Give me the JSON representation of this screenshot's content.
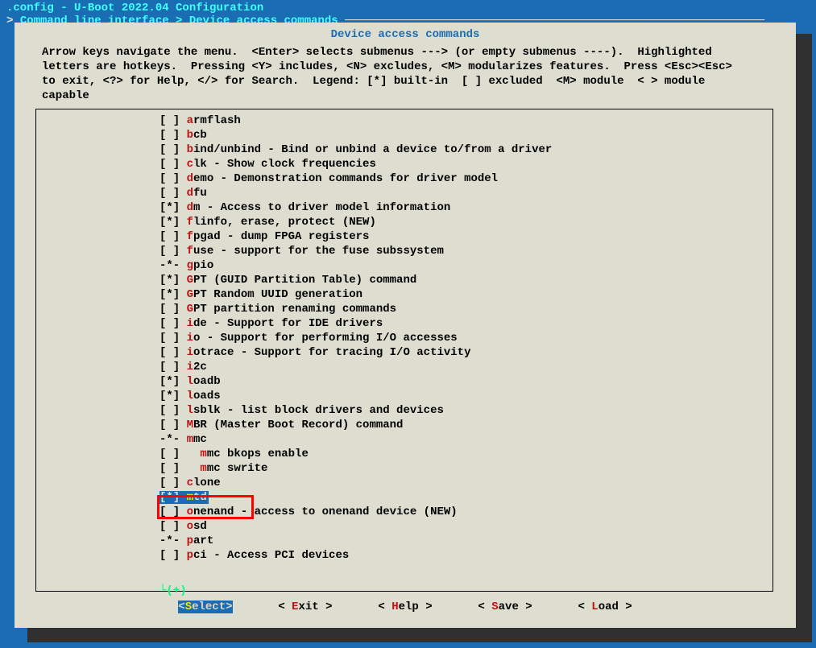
{
  "window": {
    "title": ".config - U-Boot 2022.04 Configuration",
    "breadcrumb_prefix": "> ",
    "breadcrumb_1": "Command line interface",
    "breadcrumb_sep": " > ",
    "breadcrumb_2": "Device access commands",
    "breadcrumb_trail": " ──────────────────────────────────────────────────────────────"
  },
  "box": {
    "title": "Device access commands",
    "help": "Arrow keys navigate the menu.  <Enter> selects submenus ---> (or empty submenus ----).  Highlighted\nletters are hotkeys.  Pressing <Y> includes, <N> excludes, <M> modularizes features.  Press <Esc><Esc>\nto exit, <?> for Help, </> for Search.  Legend: [*] built-in  [ ] excluded  <M> module  < > module\ncapable",
    "more": "└(+)"
  },
  "items": [
    {
      "state": "[ ] ",
      "hotkey": "a",
      "rest": "rmflash",
      "sel": false
    },
    {
      "state": "[ ] ",
      "hotkey": "b",
      "rest": "cb",
      "sel": false
    },
    {
      "state": "[ ] ",
      "hotkey": "b",
      "rest": "ind/unbind - Bind or unbind a device to/from a driver",
      "sel": false
    },
    {
      "state": "[ ] ",
      "hotkey": "c",
      "rest": "lk - Show clock frequencies",
      "sel": false
    },
    {
      "state": "[ ] ",
      "hotkey": "d",
      "rest": "emo - Demonstration commands for driver model",
      "sel": false
    },
    {
      "state": "[ ] ",
      "hotkey": "d",
      "rest": "fu",
      "sel": false
    },
    {
      "state": "[*] ",
      "hotkey": "d",
      "rest": "m - Access to driver model information",
      "sel": false
    },
    {
      "state": "[*] ",
      "hotkey": "f",
      "rest": "linfo, erase, protect (NEW)",
      "sel": false
    },
    {
      "state": "[ ] ",
      "hotkey": "f",
      "rest": "pgad - dump FPGA registers",
      "sel": false
    },
    {
      "state": "[ ] ",
      "hotkey": "f",
      "rest": "use - support for the fuse subssystem",
      "sel": false
    },
    {
      "state": "-*- ",
      "hotkey": "g",
      "rest": "pio",
      "sel": false
    },
    {
      "state": "[*] ",
      "hotkey": "G",
      "rest": "PT (GUID Partition Table) command",
      "sel": false
    },
    {
      "state": "[*] ",
      "hotkey": "G",
      "rest": "PT Random UUID generation",
      "sel": false
    },
    {
      "state": "[ ] ",
      "hotkey": "G",
      "rest": "PT partition renaming commands",
      "sel": false
    },
    {
      "state": "[ ] ",
      "hotkey": "i",
      "rest": "de - Support for IDE drivers",
      "sel": false
    },
    {
      "state": "[ ] ",
      "hotkey": "i",
      "rest": "o - Support for performing I/O accesses",
      "sel": false
    },
    {
      "state": "[ ] ",
      "hotkey": "i",
      "rest": "otrace - Support for tracing I/O activity",
      "sel": false
    },
    {
      "state": "[ ] ",
      "hotkey": "i",
      "rest": "2c",
      "sel": false
    },
    {
      "state": "[*] ",
      "hotkey": "l",
      "rest": "oadb",
      "sel": false
    },
    {
      "state": "[*] ",
      "hotkey": "l",
      "rest": "oads",
      "sel": false
    },
    {
      "state": "[ ] ",
      "hotkey": "l",
      "rest": "sblk - list block drivers and devices",
      "sel": false
    },
    {
      "state": "[ ] ",
      "hotkey": "M",
      "rest": "BR (Master Boot Record) command",
      "sel": false
    },
    {
      "state": "-*- ",
      "hotkey": "m",
      "rest": "mc",
      "sel": false
    },
    {
      "state": "[ ]   ",
      "hotkey": "m",
      "rest": "mc bkops enable",
      "sel": false
    },
    {
      "state": "[ ]   ",
      "hotkey": "m",
      "rest": "mc swrite",
      "sel": false
    },
    {
      "state": "[ ] ",
      "hotkey": "c",
      "rest": "lone",
      "sel": false
    },
    {
      "state": "[*] ",
      "hotkey": "m",
      "rest": "td",
      "sel": true
    },
    {
      "state": "[ ] ",
      "hotkey": "o",
      "rest": "nenand - access to onenand device (NEW)",
      "sel": false
    },
    {
      "state": "[ ] ",
      "hotkey": "o",
      "rest": "sd",
      "sel": false
    },
    {
      "state": "-*- ",
      "hotkey": "p",
      "rest": "art",
      "sel": false
    },
    {
      "state": "[ ] ",
      "hotkey": "p",
      "rest": "ci - Access PCI devices",
      "sel": false
    }
  ],
  "buttons": {
    "select": "<Select>",
    "exit_l": "< ",
    "exit_h": "E",
    "exit_r": "xit >",
    "help_l": "< ",
    "help_h": "H",
    "help_r": "elp >",
    "save_l": "< ",
    "save_h": "S",
    "save_r": "ave >",
    "load_l": "< ",
    "load_h": "L",
    "load_r": "oad >"
  }
}
